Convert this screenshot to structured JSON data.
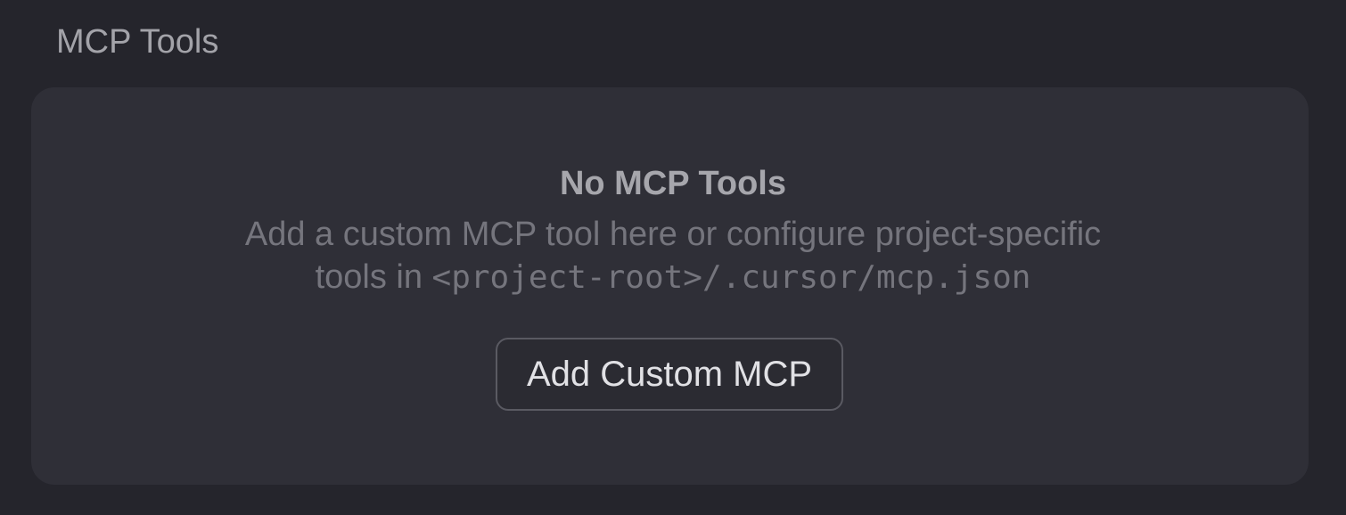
{
  "section": {
    "title": "MCP Tools"
  },
  "empty_state": {
    "title": "No MCP Tools",
    "description_line1": "Add a custom MCP tool here or configure project-specific",
    "description_line2_prefix": "tools in ",
    "description_line2_path": "<project-root>/.cursor/mcp.json",
    "button_label": "Add Custom MCP"
  },
  "colors": {
    "page_background": "#25252c",
    "card_background": "#2f2f37",
    "title_text": "#a6a6ac",
    "muted_text": "#75757d",
    "button_border": "#5a5a62",
    "button_text": "#e1e1e5"
  }
}
